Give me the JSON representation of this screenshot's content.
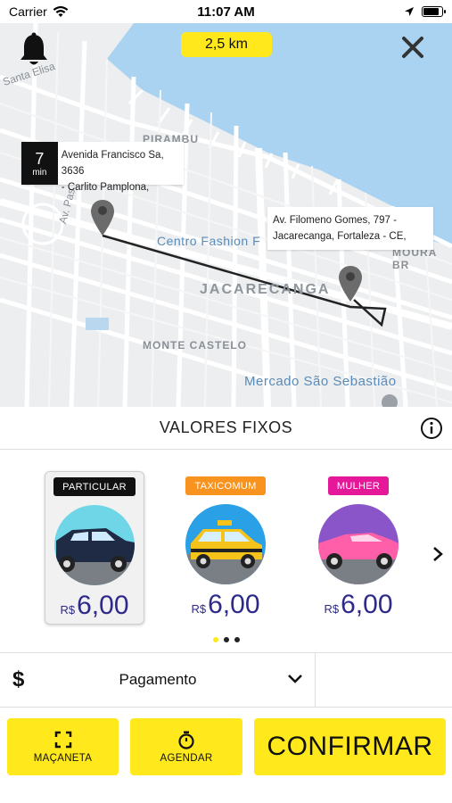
{
  "status_bar": {
    "carrier": "Carrier",
    "time": "11:07 AM",
    "battery_level": 0.9
  },
  "map": {
    "distance": "2,5 km",
    "labels": {
      "santa_elisa": "Santa Elisa",
      "pirambu": "PIRAMBU",
      "av_pas": "Av. Pas",
      "centro_fashion": "Centro Fashion F",
      "moura_br": "MOURA BR",
      "jacarecanga": "JACARECANGA",
      "monte_castelo": "MONTE CASTELO",
      "mercado": "Mercado São Sebastião"
    },
    "origin": {
      "eta_value": "7",
      "eta_unit": "min",
      "address_line1": "Avenida Francisco Sa, 3636",
      "address_line2": "- Carlito Pamplona,"
    },
    "destination": {
      "address_line1": "Av. Filomeno Gomes, 797 -",
      "address_line2": "Jacarecanga, Fortaleza - CE,"
    }
  },
  "section": {
    "title": "VALORES FIXOS"
  },
  "categories": [
    {
      "badge": "PARTICULAR",
      "badge_bg": "#111111",
      "badge_fg": "#ffffff",
      "currency": "R$",
      "price": "6,00",
      "circle_bg": "#6fd6e8",
      "car_color": "#1f2a44",
      "selected": true
    },
    {
      "badge": "TAXICOMUM",
      "badge_bg": "#f7931e",
      "badge_fg": "#ffffff",
      "currency": "R$",
      "price": "6,00",
      "circle_bg": "#2aa0e6",
      "car_color": "#f6c31a",
      "selected": false
    },
    {
      "badge": "MULHER",
      "badge_bg": "#e6189a",
      "badge_fg": "#ffffff",
      "currency": "R$",
      "price": "6,00",
      "circle_bg": "#8a55c9",
      "car_color": "#ff5fa8",
      "selected": false
    }
  ],
  "pager": {
    "pages": 3,
    "active": 0
  },
  "payment": {
    "icon": "$",
    "label": "Pagamento"
  },
  "actions": {
    "door": "MAÇANETA",
    "schedule": "AGENDAR",
    "confirm": "CONFIRMAR"
  },
  "colors": {
    "accent": "#ffe81c",
    "price": "#2e2a8c",
    "water": "#a9d3f0"
  }
}
